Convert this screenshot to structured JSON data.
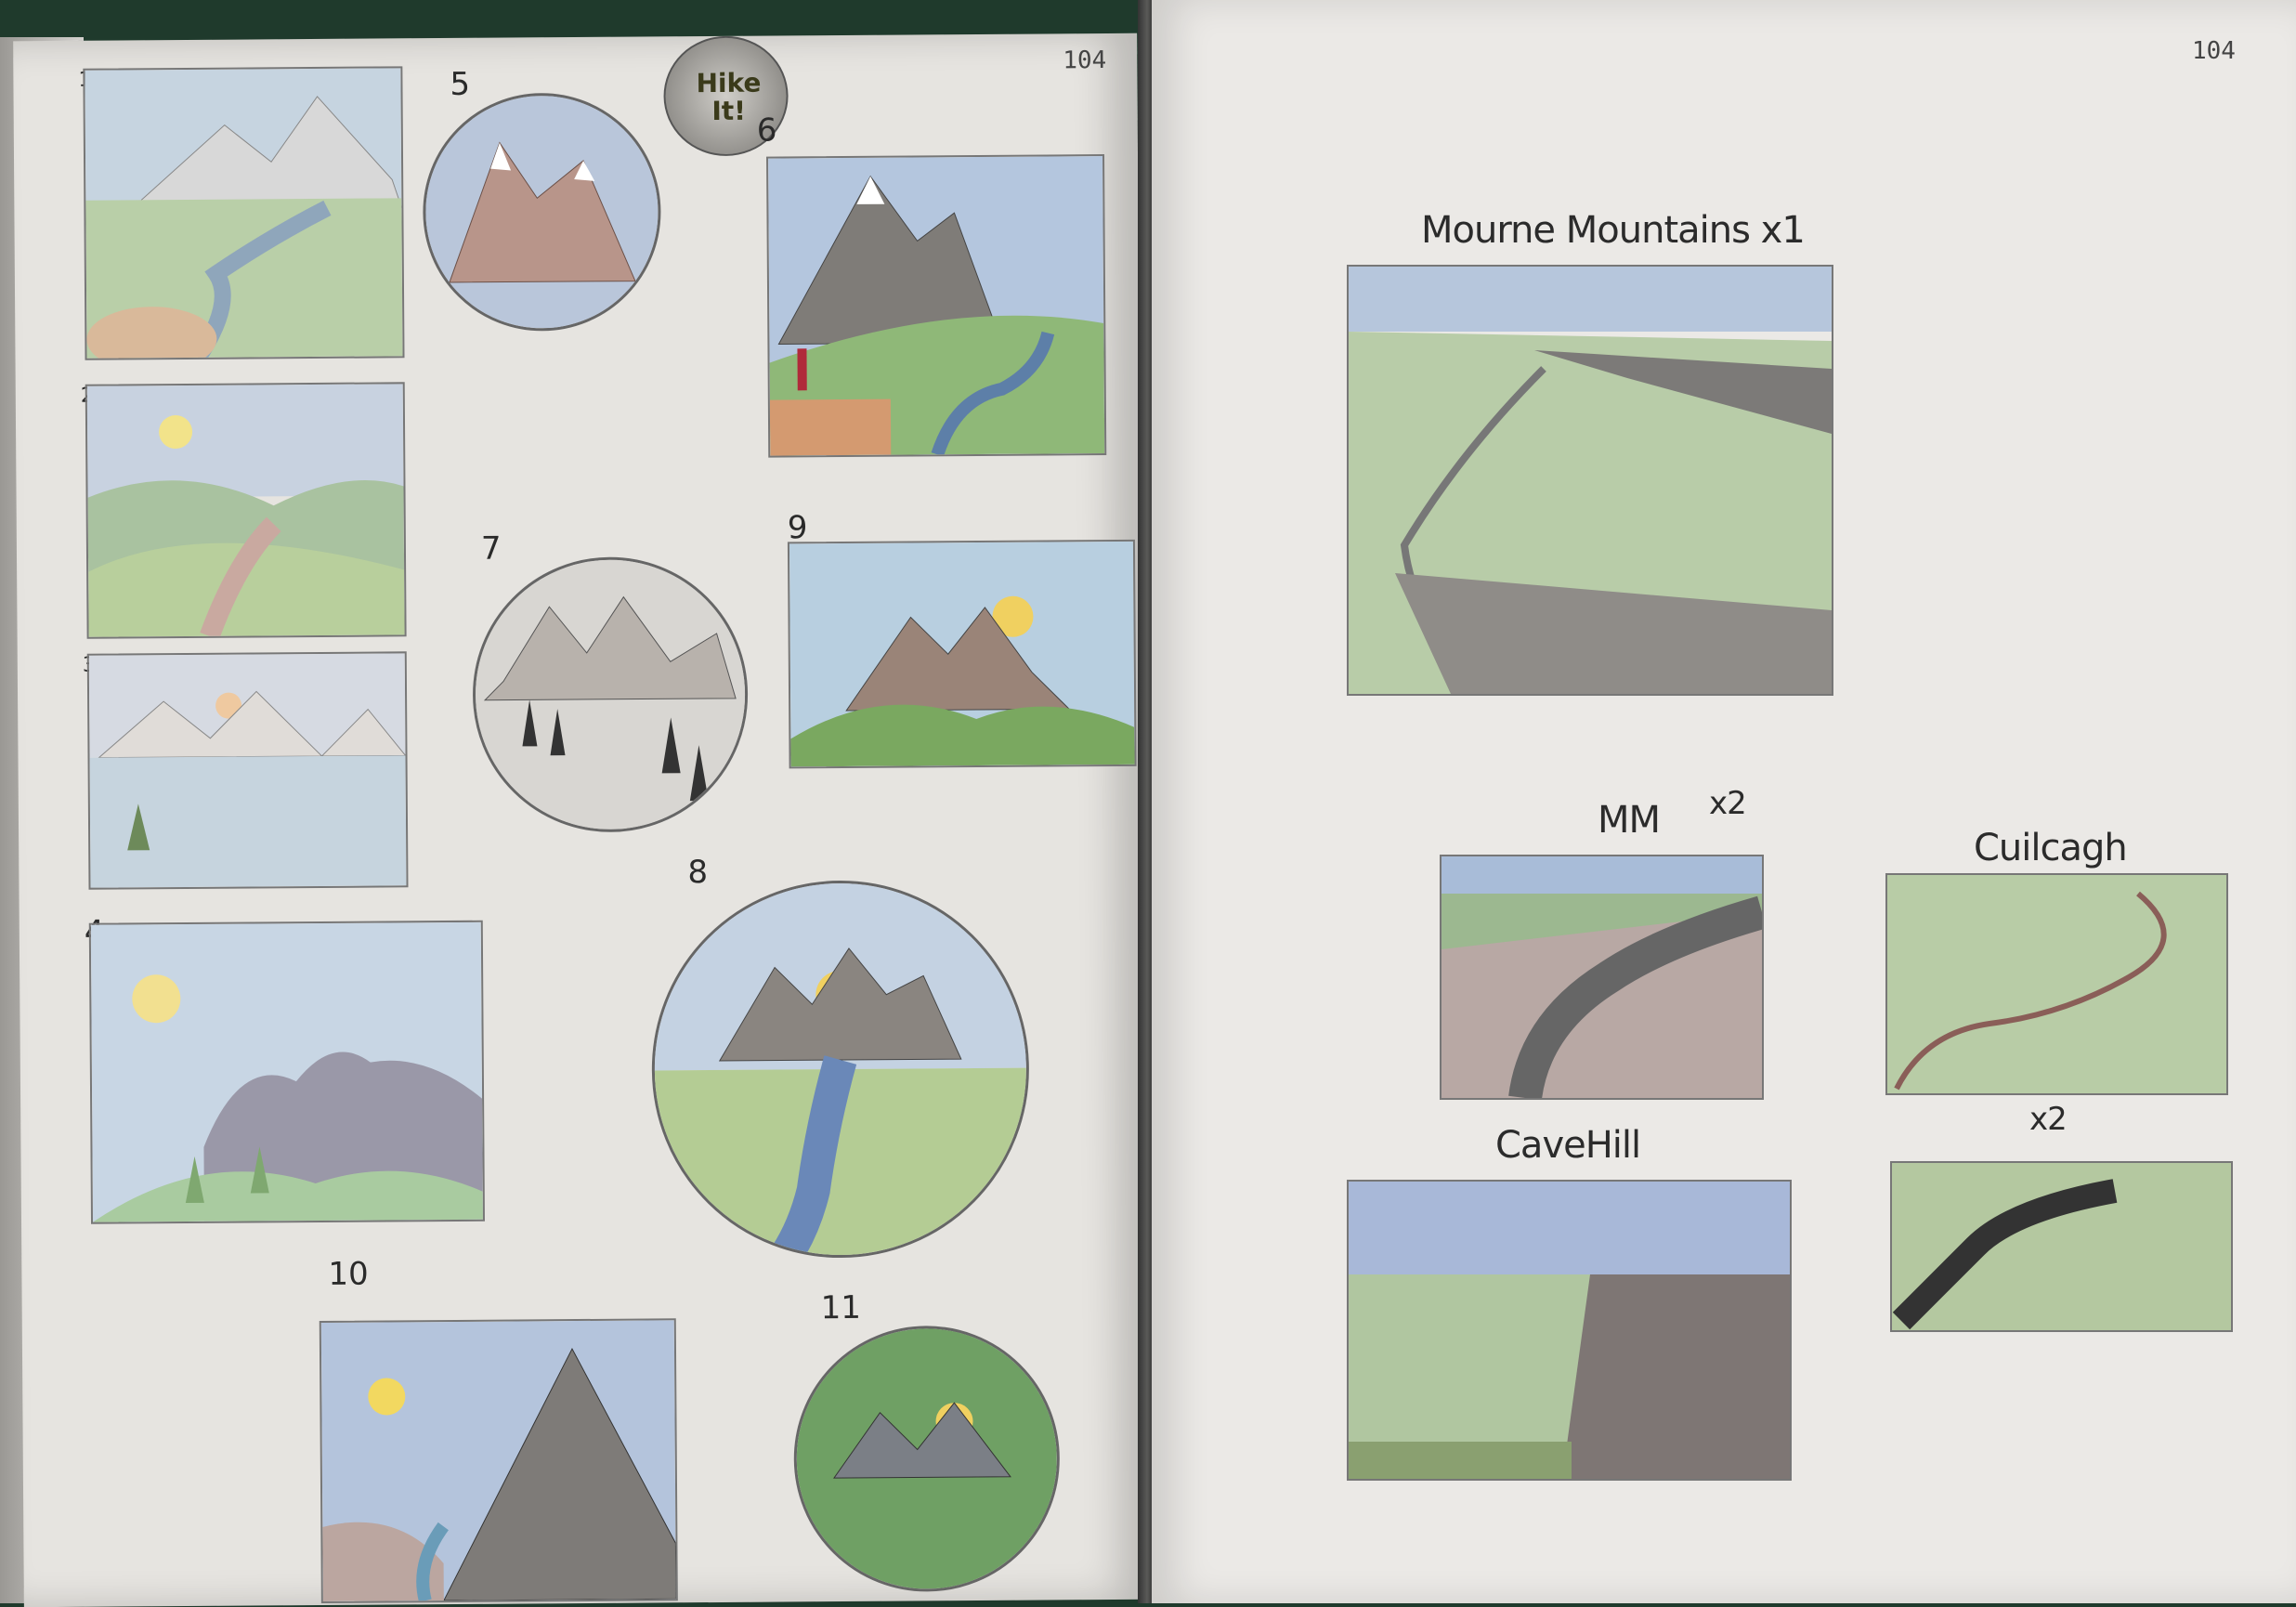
{
  "left_page": {
    "page_number": "104",
    "logo_text": "Hike It!",
    "sketch_numbers": [
      "1",
      "2",
      "3",
      "4",
      "5",
      "6",
      "7",
      "8",
      "9",
      "10",
      "11"
    ]
  },
  "right_page": {
    "page_number": "104",
    "labels": {
      "mourne": "Mourne Mountains x1",
      "mm": "MM",
      "mm_count": "x2",
      "cuilcagh": "Cuilcagh",
      "cavehill": "CaveHill",
      "x2": "x2"
    }
  },
  "colors": {
    "paper": "#e6e4e0",
    "background": "#1f3a2c",
    "sky": "#b8c8dc",
    "grass": "#a8c49a",
    "mountain": "#8a8078"
  }
}
